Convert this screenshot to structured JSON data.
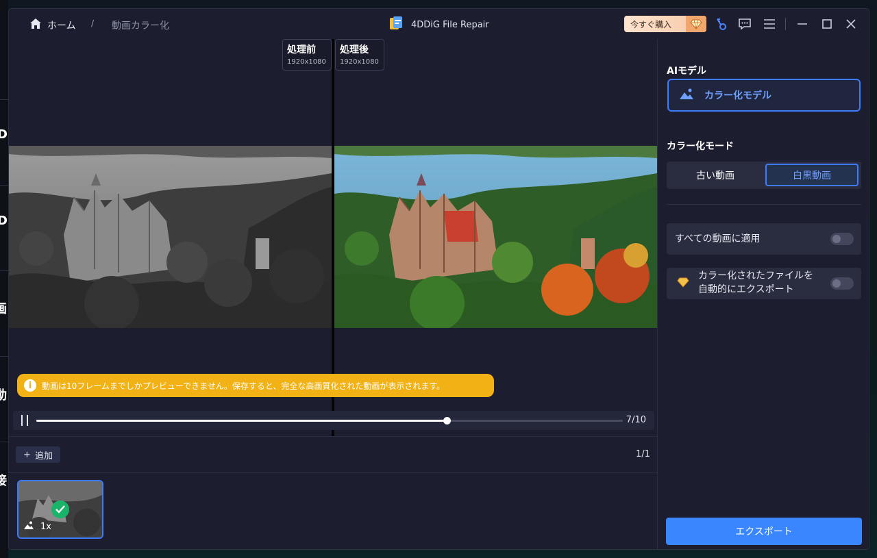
{
  "breadcrumb": {
    "home_label": "ホーム",
    "separator": "/",
    "current": "動画カラー化"
  },
  "app": {
    "title": "4DDiG File Repair"
  },
  "header": {
    "buy_label": "今すぐ購入"
  },
  "background_app": {
    "glyphs": [
      "D",
      "D",
      "画",
      "動",
      "接"
    ]
  },
  "preview": {
    "before": {
      "label": "処理前",
      "resolution": "1920x1080"
    },
    "after": {
      "label": "処理後",
      "resolution": "1920x1080"
    },
    "notice": "動画は10フレームまでしかプレビューできません。保存すると、完全な高画質化された動画が表示されます。",
    "frame_counter": "7/10",
    "progress_fraction": 0.7
  },
  "filelist": {
    "add_label": "追加",
    "page_counter": "1/1",
    "thumb_speed": "1x"
  },
  "panel": {
    "ai_model_title": "AIモデル",
    "model_label": "カラー化モデル",
    "mode_title": "カラー化モード",
    "mode_old": "古い動画",
    "mode_bw": "白黒動画",
    "apply_all_label": "すべての動画に適用",
    "auto_export_line1": "カラー化されたファイルを",
    "auto_export_line2": "自動的にエクスポート",
    "export_label": "エクスポート"
  },
  "colors": {
    "accent": "#3d7bff",
    "notice": "#f2b115",
    "export": "#3a86ff",
    "check": "#19b46a"
  }
}
